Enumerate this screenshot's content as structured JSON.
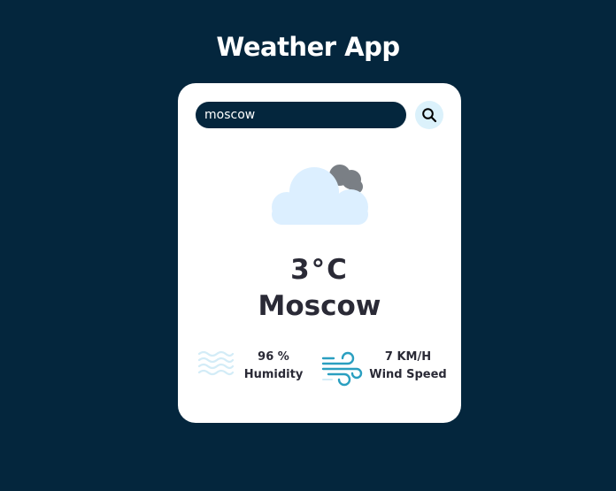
{
  "app": {
    "title": "Weather App"
  },
  "search": {
    "value": "moscow",
    "icon": "search-icon"
  },
  "weather": {
    "icon": "cloudy-icon",
    "temperature": "3°C",
    "city": "Moscow"
  },
  "stats": {
    "humidity": {
      "value": "96 %",
      "label": "Humidity",
      "icon": "humidity-icon"
    },
    "wind": {
      "value": "7 KM/H",
      "label": "Wind Speed",
      "icon": "wind-icon"
    }
  },
  "colors": {
    "background": "#04263d",
    "card": "#ffffff",
    "text": "#2a2a36",
    "search_button": "#dbf1fb",
    "cloud_light": "#dcefff",
    "cloud_dark": "#7a7f85",
    "wind_icon": "#2a9fc0",
    "humidity_icon": "#d3ecf7"
  }
}
